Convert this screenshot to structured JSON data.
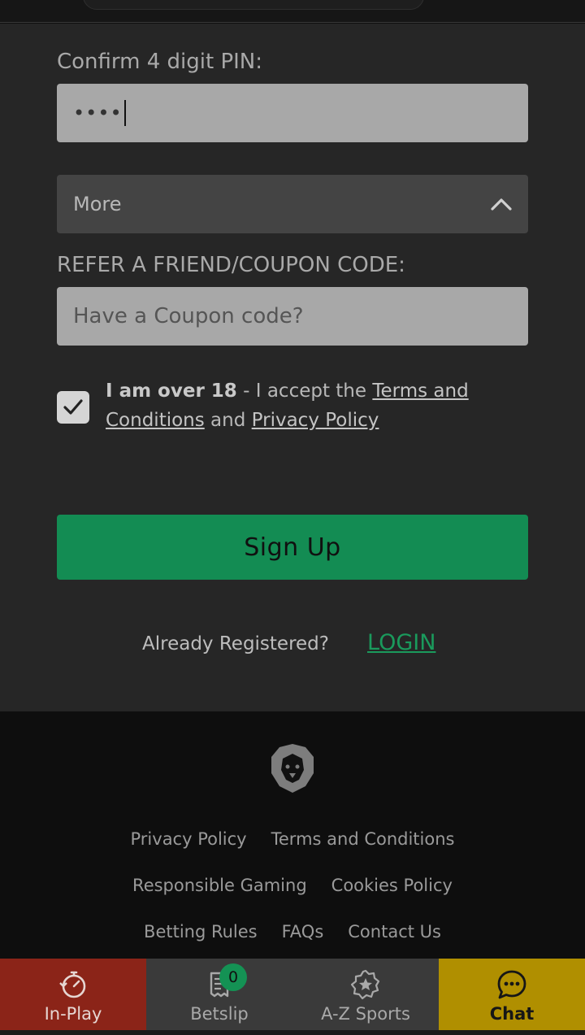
{
  "form": {
    "pin_label": "Confirm 4 digit PIN:",
    "pin_value": "••••",
    "more_label": "More",
    "coupon_label": "REFER A FRIEND/COUPON CODE:",
    "coupon_placeholder": "Have a Coupon code?",
    "terms": {
      "bold": "I am over 18",
      "sep": " - I accept the ",
      "terms_link": "Terms and Conditions",
      "and": " and ",
      "privacy_link": "Privacy Policy"
    },
    "signup_label": "Sign Up",
    "already_text": "Already Registered?",
    "login_label": "LOGIN"
  },
  "footer": {
    "row1": [
      "Privacy Policy",
      "Terms and Conditions"
    ],
    "row2": [
      "Responsible Gaming",
      "Cookies Policy"
    ],
    "row3": [
      "Betting Rules",
      "FAQs",
      "Contact Us"
    ]
  },
  "nav": {
    "inplay": "In-Play",
    "betslip": "Betslip",
    "betslip_count": "0",
    "azsports": "A-Z Sports",
    "chat": "Chat"
  },
  "colors": {
    "accent_green": "#138c53",
    "inplay_red": "#8b2418",
    "chat_yellow": "#b08f00"
  }
}
